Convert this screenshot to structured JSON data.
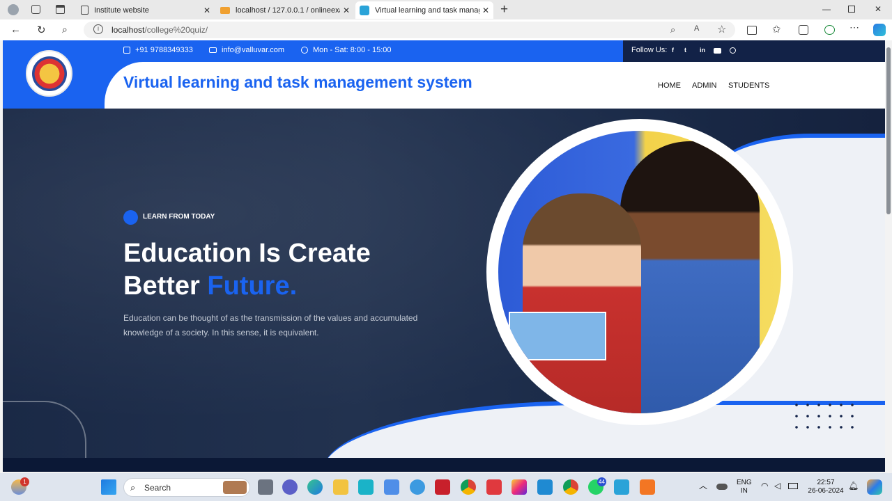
{
  "browser": {
    "tabs": [
      {
        "label": "Institute website",
        "active": false
      },
      {
        "label": "localhost / 127.0.0.1 / onlineexan",
        "active": false
      },
      {
        "label": "Virtual learning and task manage",
        "active": true
      }
    ],
    "new_tab": "+",
    "url_host": "localhost",
    "url_path": "/college%20quiz/"
  },
  "topbar": {
    "phone": "+91 9788349333",
    "email": "info@valluvar.com",
    "hours": "Mon - Sat: 8:00 - 15:00",
    "follow_label": "Follow Us:",
    "social_icons": [
      "facebook-icon",
      "twitter-icon",
      "linkedin-icon",
      "youtube-icon",
      "skype-icon"
    ]
  },
  "header": {
    "site_title": "Virtual learning and task management system",
    "menu": [
      "HOME",
      "ADMIN",
      "STUDENTS"
    ]
  },
  "hero": {
    "kicker": "LEARN FROM TODAY",
    "headline_line1": "Education Is Create",
    "headline_line2_prefix": "Better ",
    "headline_line2_highlight": "Future.",
    "paragraph": "Education can be thought of as the transmission of the values and accumulated knowledge of a society. In this sense, it is equivalent.",
    "slider_active_index": 0,
    "slider_count": 3
  },
  "taskbar": {
    "search_label": "Search",
    "weather_badge": "1",
    "whatsapp_badge": "44",
    "lang_line1": "ENG",
    "lang_line2": "IN",
    "time": "22:57",
    "date": "26-06-2024"
  },
  "colors": {
    "brand_blue": "#1a63f0",
    "hero_dark": "#1a2946"
  }
}
